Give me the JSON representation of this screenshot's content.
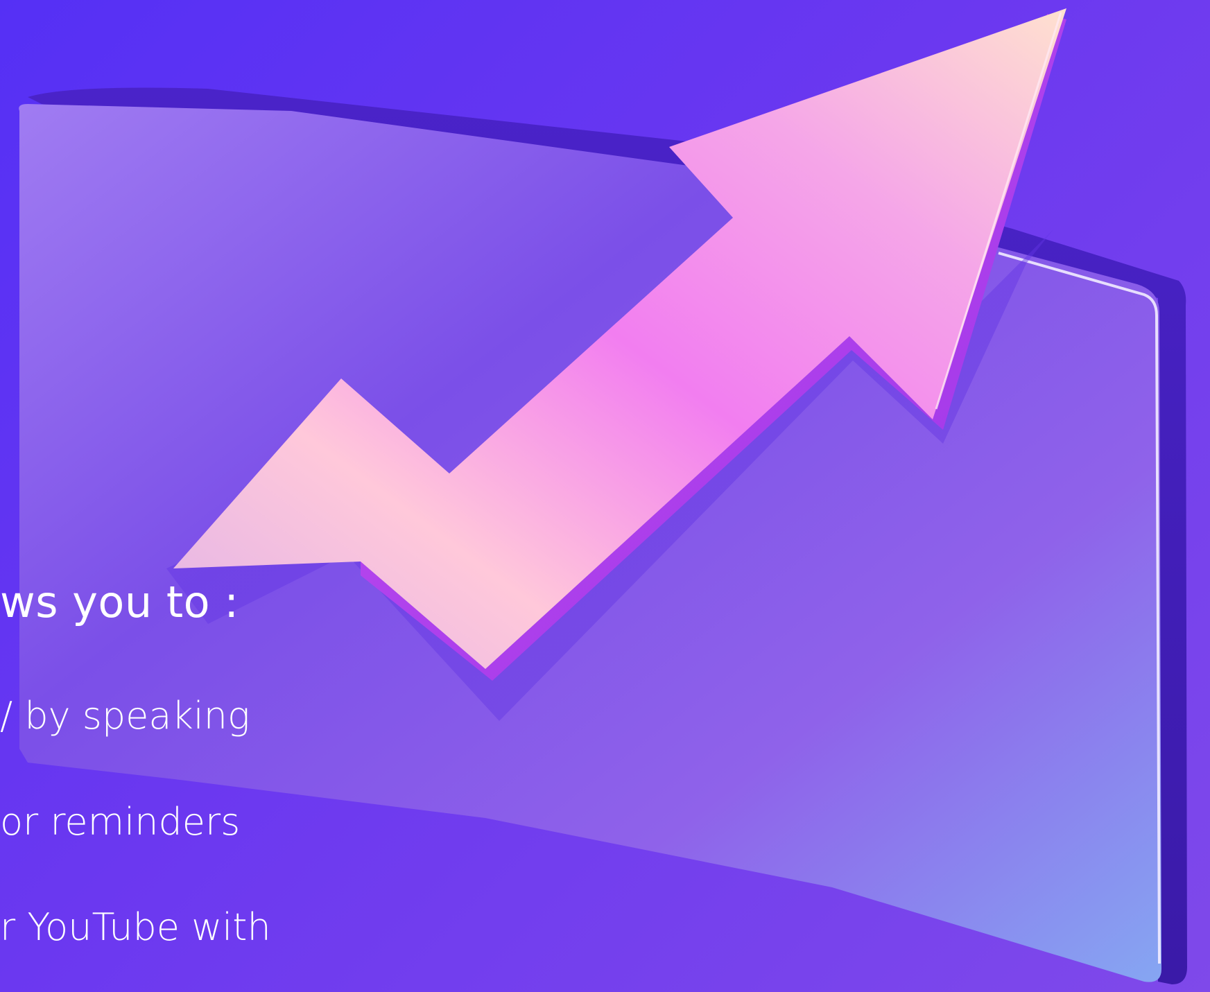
{
  "heading": "ws you to :",
  "lines": [
    "/ by speaking",
    "or reminders",
    "r YouTube with"
  ]
}
